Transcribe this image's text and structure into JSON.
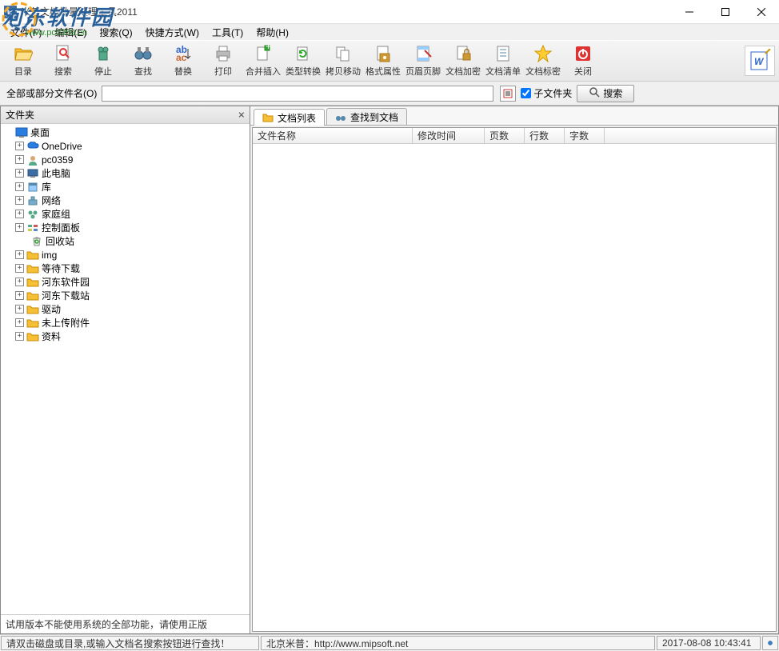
{
  "window": {
    "title": "米普文档批量处理工具2011"
  },
  "watermark": {
    "text": "河东软件园",
    "url": "www.pc0359.cn"
  },
  "menu": {
    "file": "文件(F)",
    "edit": "编辑(E)",
    "search": "搜索(Q)",
    "shortcut": "快捷方式(W)",
    "tool": "工具(T)",
    "help": "帮助(H)"
  },
  "toolbar": {
    "dir": "目录",
    "search": "搜索",
    "stop": "停止",
    "find": "查找",
    "replace": "替换",
    "print": "打印",
    "merge": "合并插入",
    "convert": "类型转换",
    "copymove": "拷贝移动",
    "format": "格式属性",
    "header": "页眉页脚",
    "encrypt": "文档加密",
    "list": "文档清单",
    "secret": "文档标密",
    "close": "关闭"
  },
  "search_bar": {
    "label": "全部或部分文件名(O)",
    "subfolder": "子文件夹",
    "button": "搜索",
    "value": ""
  },
  "left": {
    "title": "文件夹"
  },
  "tree": {
    "root": "桌面",
    "items": [
      {
        "label": "OneDrive"
      },
      {
        "label": "pc0359"
      },
      {
        "label": "此电脑"
      },
      {
        "label": "库"
      },
      {
        "label": "网络"
      },
      {
        "label": "家庭组"
      },
      {
        "label": "控制面板"
      },
      {
        "label": "回收站"
      },
      {
        "label": "img"
      },
      {
        "label": "等待下载"
      },
      {
        "label": "河东软件园"
      },
      {
        "label": "河东下载站"
      },
      {
        "label": "驱动"
      },
      {
        "label": "未上传附件"
      },
      {
        "label": "资料"
      }
    ]
  },
  "trial": "试用版本不能使用系统的全部功能，请使用正版",
  "tabs": {
    "doclist": "文档列表",
    "found": "查找到文档"
  },
  "columns": {
    "filename": "文件名称",
    "modtime": "修改时间",
    "pages": "页数",
    "lines": "行数",
    "chars": "字数"
  },
  "status": {
    "left": "请双击磁盘或目录,或输入文档名搜索按钮进行查找！",
    "mid": "北京米普：http://www.mipsoft.net",
    "time": "2017-08-08 10:43:41"
  }
}
